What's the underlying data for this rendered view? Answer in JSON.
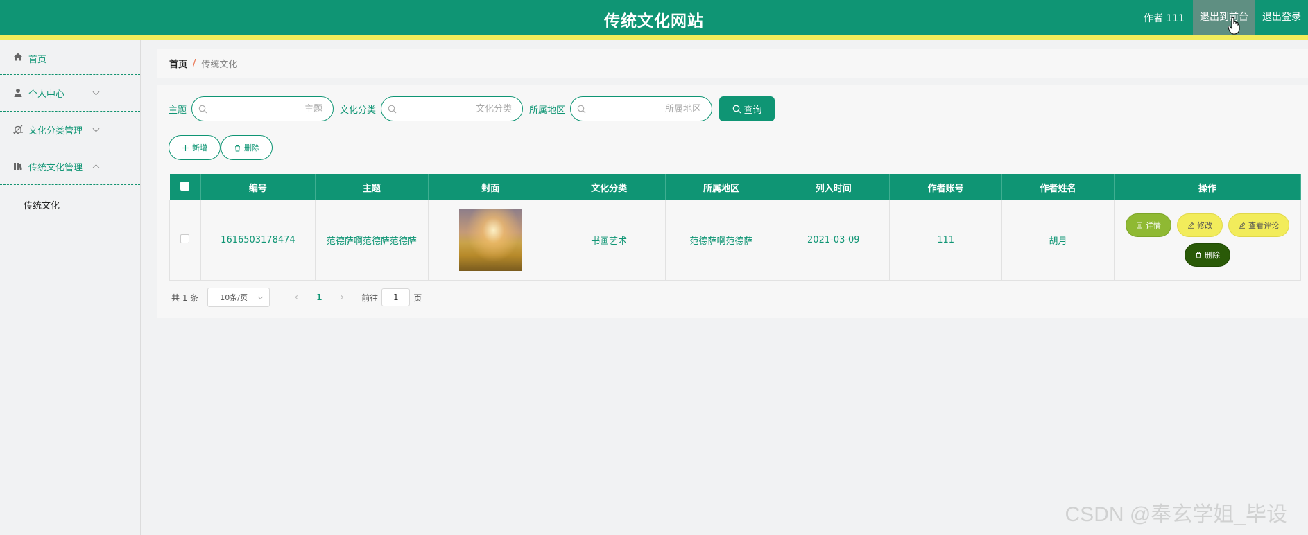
{
  "header": {
    "site_title": "传统文化网站",
    "author_text": "作者 111",
    "back_to_front": "退出到前台",
    "logout": "退出登录"
  },
  "sidebar": {
    "items": [
      {
        "label": "首页",
        "icon": "home-icon"
      },
      {
        "label": "个人中心",
        "icon": "user-icon",
        "expanded": false
      },
      {
        "label": "文化分类管理",
        "icon": "bell-icon",
        "expanded": false
      },
      {
        "label": "传统文化管理",
        "icon": "book-icon",
        "expanded": true
      }
    ],
    "submenu": [
      {
        "label": "传统文化"
      }
    ]
  },
  "breadcrumb": {
    "home": "首页",
    "separator": "/",
    "current": "传统文化"
  },
  "search": {
    "fields": [
      {
        "label": "主题",
        "placeholder": "主题",
        "value": ""
      },
      {
        "label": "文化分类",
        "placeholder": "文化分类",
        "value": ""
      },
      {
        "label": "所属地区",
        "placeholder": "所属地区",
        "value": ""
      }
    ],
    "query_label": "查询"
  },
  "actions": {
    "add_label": "新增",
    "delete_label": "删除"
  },
  "table": {
    "columns": [
      "编号",
      "主题",
      "封面",
      "文化分类",
      "所属地区",
      "列入时间",
      "作者账号",
      "作者姓名",
      "操作"
    ],
    "rows": [
      {
        "id": "1616503178474",
        "theme": "范德萨啊范德萨范德萨",
        "category": "书画艺术",
        "region": "范德萨啊范德萨",
        "date": "2021-03-09",
        "account": "111",
        "name": "胡月"
      }
    ],
    "ops": {
      "detail": "详情",
      "edit": "修改",
      "comments": "查看评论",
      "delete": "删除"
    }
  },
  "pagination": {
    "total_text": "共 1 条",
    "page_size": "10条/页",
    "current_page": "1",
    "goto_label": "前往",
    "goto_value": "1",
    "goto_suffix": "页"
  },
  "watermark": "CSDN @奉玄学姐_毕设",
  "colors": {
    "primary": "#0f9574",
    "accent_yellow": "#f2ec5b",
    "detail_green": "#8fb933",
    "delete_dark": "#2a5a08"
  }
}
